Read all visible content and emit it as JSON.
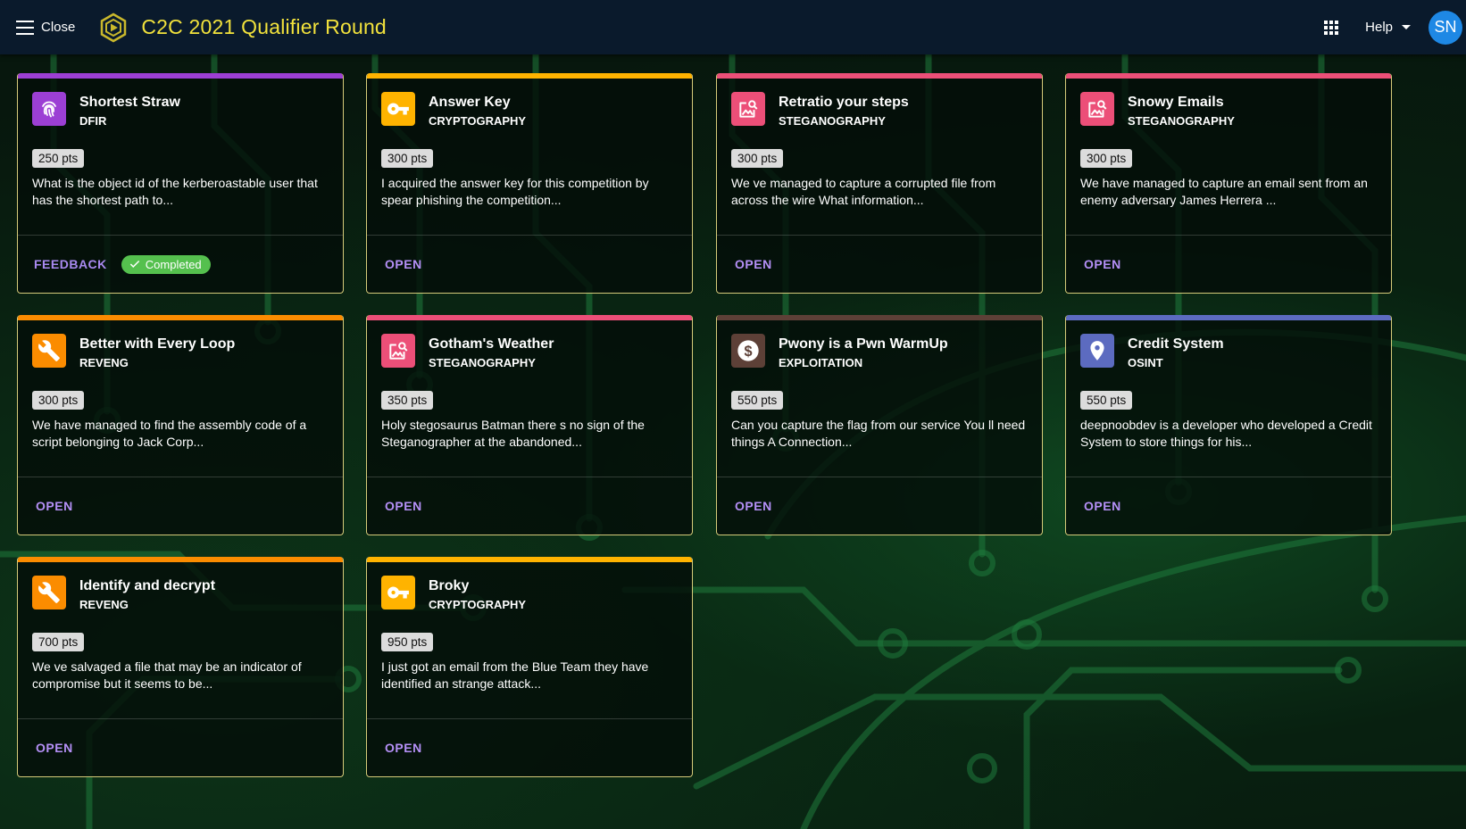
{
  "topbar": {
    "close_label": "Close",
    "title": "C2C 2021 Qualifier Round",
    "help_label": "Help",
    "avatar_initials": "SN",
    "title_color": "#f2e23c"
  },
  "colors": {
    "DFIR": "#9c3fd4",
    "CRYPTOGRAPHY": "#ffb300",
    "STEGANOGRAPHY": "#ec4f78",
    "REVENG": "#fb8c00",
    "EXPLOITATION": "#5d4037",
    "OSINT": "#5c6bc0",
    "completed_badge": "#55c04e",
    "action_text": "#b590f7"
  },
  "cards": [
    {
      "title": "Shortest Straw",
      "category": "DFIR",
      "icon": "fingerprint-icon",
      "points": "250 pts",
      "description": "What is the object id of the kerberoastable user that has the shortest path to...",
      "action": "FEEDBACK",
      "status": "Completed"
    },
    {
      "title": "Answer Key",
      "category": "CRYPTOGRAPHY",
      "icon": "key-icon",
      "points": "300 pts",
      "description": "I acquired the answer key for this competition by spear phishing the competition...",
      "action": "OPEN"
    },
    {
      "title": "Retratio your steps",
      "category": "STEGANOGRAPHY",
      "icon": "image-search-icon",
      "points": "300 pts",
      "description": "We ve managed to capture a corrupted file from across the wire  What information...",
      "action": "OPEN"
    },
    {
      "title": "Snowy Emails",
      "category": "STEGANOGRAPHY",
      "icon": "image-search-icon",
      "points": "300 pts",
      "description": "We have managed to capture an email sent from an enemy adversary  James Herrera ...",
      "action": "OPEN"
    },
    {
      "title": "Better with Every Loop",
      "category": "REVENG",
      "icon": "wrench-icon",
      "points": "300 pts",
      "description": "We have managed to find the assembly code of a script belonging to Jack Corp...",
      "action": "OPEN"
    },
    {
      "title": "Gotham's Weather",
      "category": "STEGANOGRAPHY",
      "icon": "image-search-icon",
      "points": "350 pts",
      "description": "Holy stegosaurus Batman  there s no sign of the Steganographer at the abandoned...",
      "action": "OPEN"
    },
    {
      "title": "Pwony is a Pwn WarmUp",
      "category": "EXPLOITATION",
      "icon": "dollar-icon",
      "points": "550 pts",
      "description": "Can you capture the flag from our service  You ll need things    A Connection...",
      "action": "OPEN"
    },
    {
      "title": "Credit System",
      "category": "OSINT",
      "icon": "location-pin-icon",
      "points": "550 pts",
      "description": "deepnoobdev is a developer who developed a Credit System to store things for his...",
      "action": "OPEN"
    },
    {
      "title": "Identify and decrypt",
      "category": "REVENG",
      "icon": "wrench-icon",
      "points": "700 pts",
      "description": "We ve salvaged a file that may be an indicator of compromise  but it seems to be...",
      "action": "OPEN"
    },
    {
      "title": "Broky",
      "category": "CRYPTOGRAPHY",
      "icon": "key-icon",
      "points": "950 pts",
      "description": "I just got an email from the Blue Team  they have identified an strange attack...",
      "action": "OPEN"
    }
  ]
}
